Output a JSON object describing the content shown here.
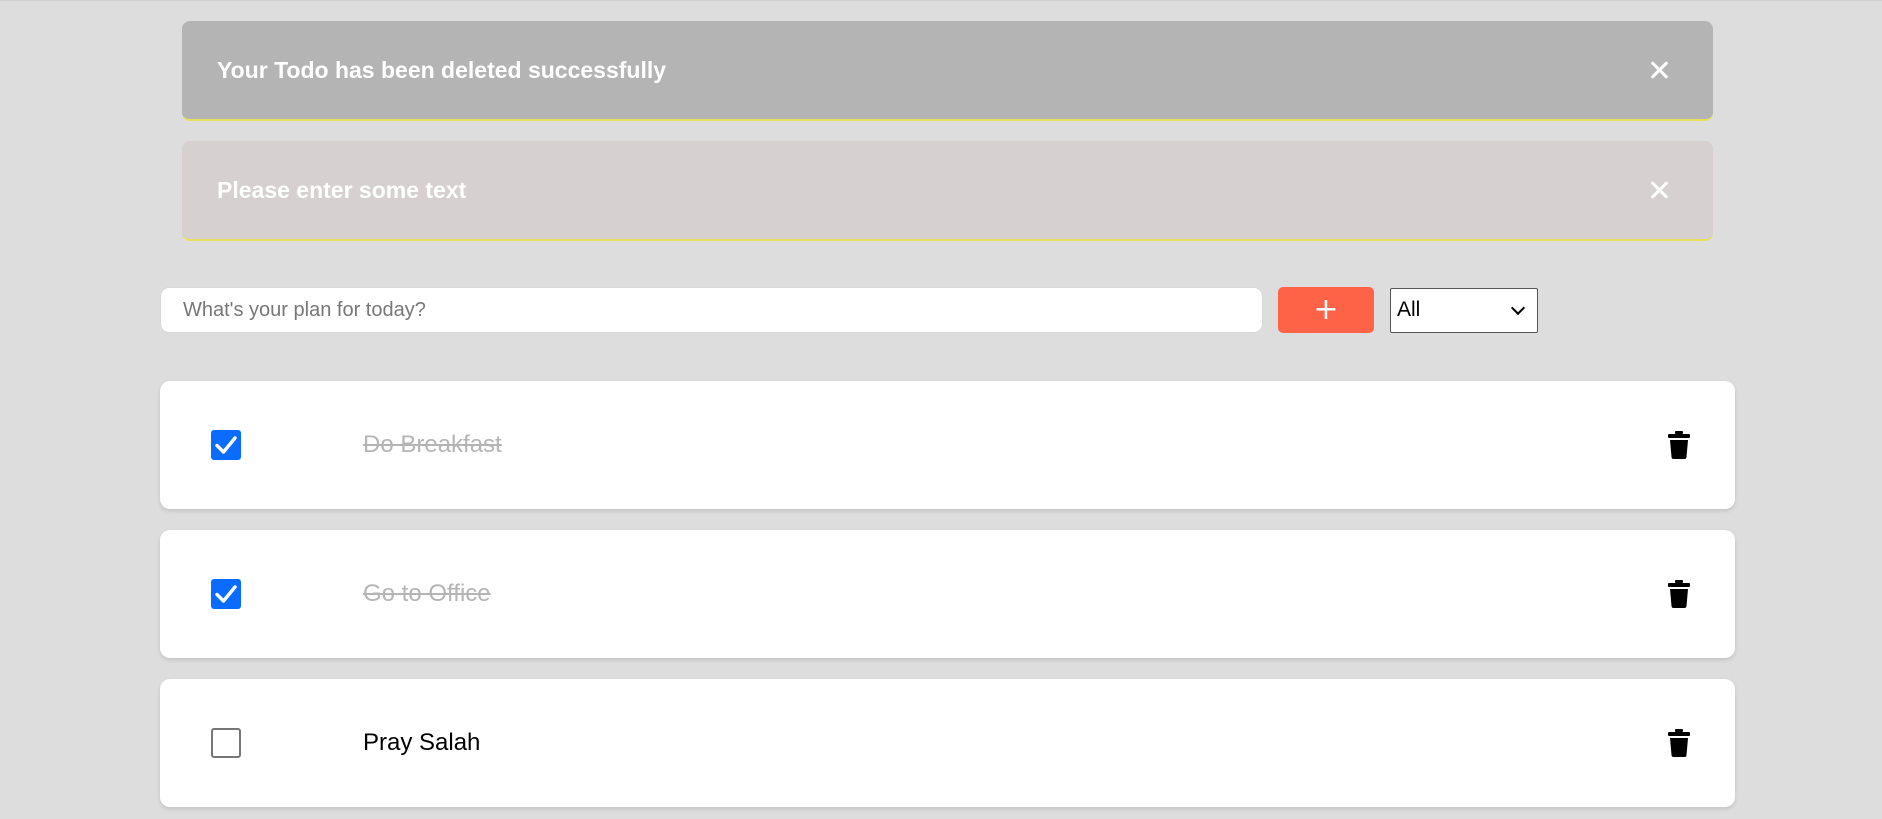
{
  "notifications": [
    {
      "message": "Your Todo has been deleted successfully",
      "background": "#b4b4b4"
    },
    {
      "message": "Please enter some text",
      "background": "#d6d0d0"
    }
  ],
  "new_todo": {
    "placeholder": "What's your plan for today?",
    "value": "",
    "add_label": "+",
    "add_color": "#ff6347"
  },
  "filter": {
    "selected": "All"
  },
  "todos": [
    {
      "text": "Do Breakfast",
      "completed": true
    },
    {
      "text": "Go to Office",
      "completed": true
    },
    {
      "text": "Pray Salah",
      "completed": false
    }
  ],
  "colors": {
    "background": "#dddddd",
    "checkbox_checked": "#0a6cff",
    "completed_text": "#b5b5b5"
  },
  "icons": {
    "close": "close-icon",
    "delete": "trash-icon",
    "check": "check-icon",
    "dropdown": "chevron-down-icon"
  }
}
